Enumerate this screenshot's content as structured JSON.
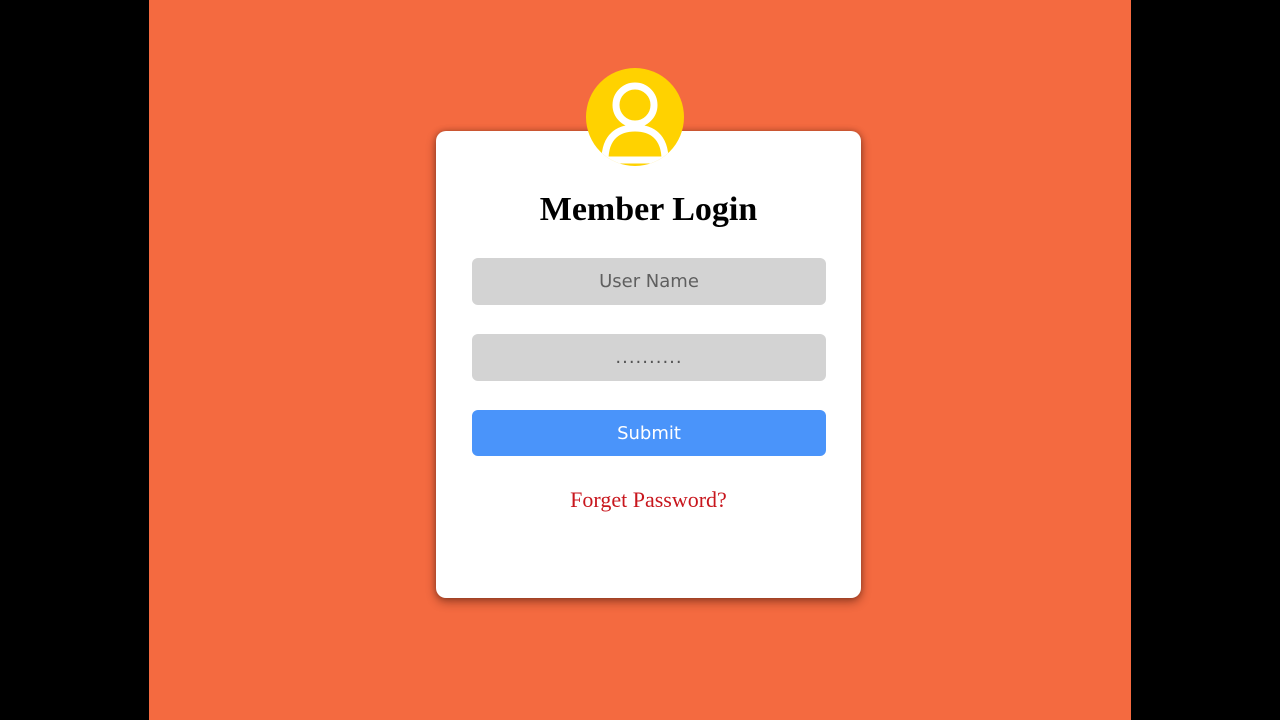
{
  "colors": {
    "page_background": "#F46A40",
    "letterbox": "#000000",
    "card_background": "#FFFFFF",
    "avatar_background": "#FFD200",
    "input_background": "#D3D3D3",
    "submit_background": "#4A94FA",
    "link_color": "#C8161D"
  },
  "avatar": {
    "icon": "user-icon"
  },
  "login": {
    "title": "Member Login",
    "username_placeholder": "User Name",
    "password_value": "..........",
    "submit_label": "Submit",
    "forgot_label": "Forget Password?"
  }
}
